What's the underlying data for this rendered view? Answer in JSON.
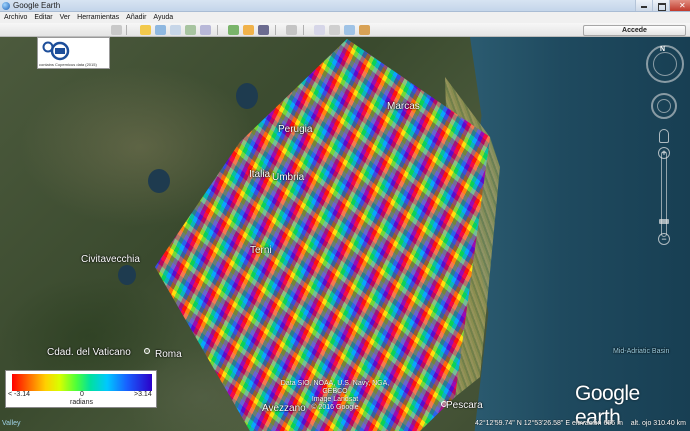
{
  "window": {
    "title": "Google Earth"
  },
  "menu": [
    "Archivo",
    "Editar",
    "Ver",
    "Herramientas",
    "Añadir",
    "Ayuda"
  ],
  "toolbar": {
    "signin_label": "Accede"
  },
  "logo": {
    "caption": "contains Copernicus data (2015)"
  },
  "places": {
    "marcas": "Marcas",
    "perugia": "Perugia",
    "italia": "Italia",
    "umbria": "Umbria",
    "terni": "Terni",
    "civitavecchia": "Civitavecchia",
    "vaticano": "Cdad. del Vaticano",
    "roma": "Roma",
    "avezzano": "Avezzano",
    "pescara": "Pescara",
    "mid_adriatic": "Mid-Adriatic Basin",
    "valley": "Valley"
  },
  "legend": {
    "min_label": "< -3.14",
    "zero_label": "0",
    "max_label": ">3.14",
    "unit": "radians"
  },
  "attribution": "Data SIO, NOAA, U.S. Navy, NGA, GEBCO\nImage Landsat\n© 2016 Google",
  "brand": "Google earth",
  "status": {
    "coords": "42°12'59.74\" N   12°53'26.58\" E   elevación   656 m",
    "eye_alt": "alt. ojo 310.40 km"
  }
}
